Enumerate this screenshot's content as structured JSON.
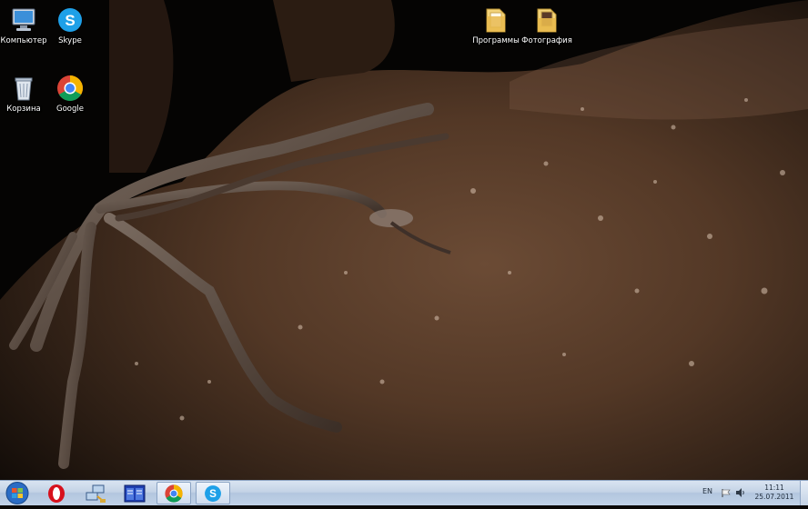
{
  "desktop": {
    "icons": [
      {
        "label": "Компьютер",
        "icon": "computer-icon"
      },
      {
        "label": "Skype",
        "icon": "skype-icon"
      },
      {
        "label": "Корзина",
        "icon": "recycle-bin-icon"
      },
      {
        "label": "Google",
        "icon": "chrome-icon"
      },
      {
        "label": "Программы",
        "icon": "folder-icon"
      },
      {
        "label": "Фотография",
        "icon": "folder-icon"
      }
    ]
  },
  "taskbar": {
    "start": {
      "icon": "windows-start-icon"
    },
    "pinned": [
      {
        "icon": "opera-icon"
      },
      {
        "icon": "network-icon"
      },
      {
        "icon": "total-commander-icon"
      },
      {
        "icon": "chrome-icon",
        "active": true
      },
      {
        "icon": "skype-icon",
        "active": true
      }
    ],
    "tray": {
      "language": "EN",
      "time": "11:11",
      "date": "25.07.2011"
    }
  },
  "colors": {
    "taskbar": "#c4d3e6",
    "skin": "#5a3f2d"
  }
}
